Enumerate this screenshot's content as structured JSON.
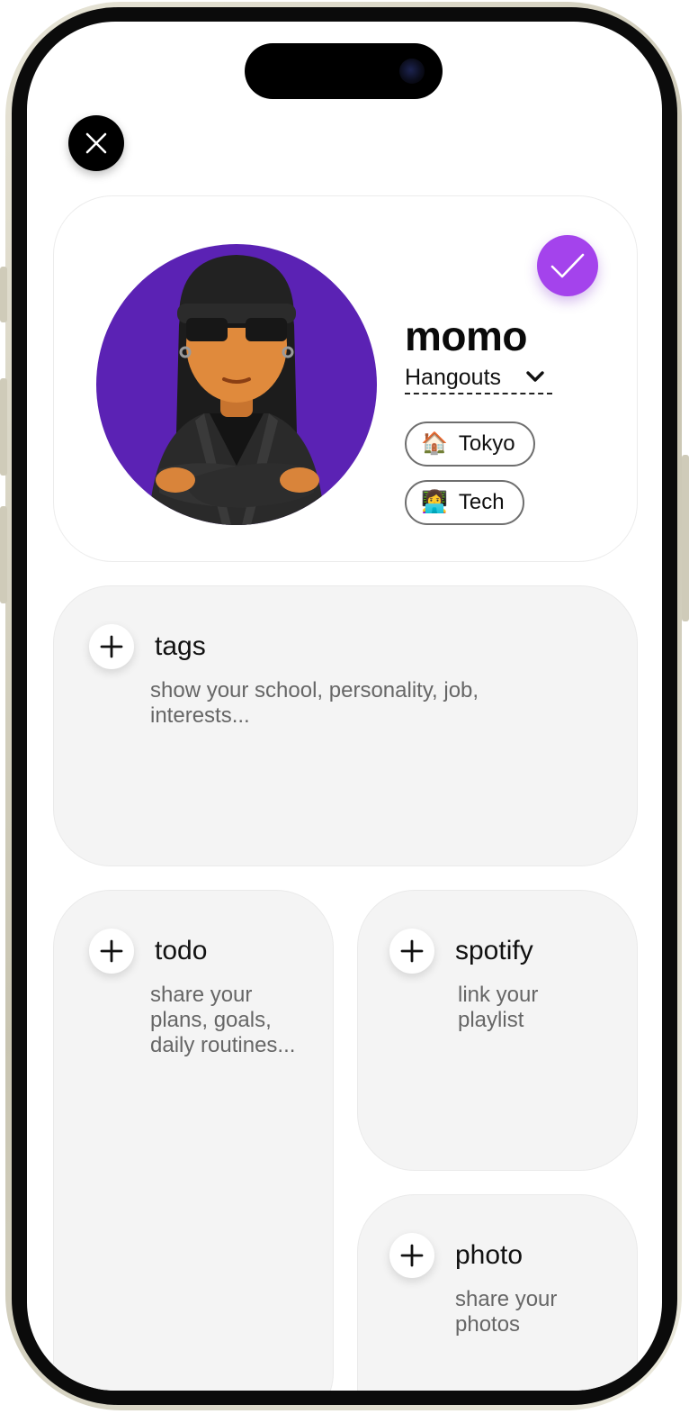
{
  "colors": {
    "accent": "#a443ec",
    "avatar_background": "#5b22b4",
    "card_background": "#f4f4f4"
  },
  "profile": {
    "name": "momo",
    "mode": "Hangouts",
    "tags": [
      {
        "emoji": "🏠",
        "label": "Tokyo"
      },
      {
        "emoji": "👩‍💻",
        "label": "Tech"
      }
    ]
  },
  "icons": {
    "close": "close-icon",
    "confirm": "checkmark-icon",
    "dropdown": "chevron-down-icon",
    "add": "plus-icon"
  },
  "widgets": {
    "tags": {
      "title": "tags",
      "description": "show your school, personality, job, interests..."
    },
    "todo": {
      "title": "todo",
      "description": "share your plans, goals, daily routines..."
    },
    "spotify": {
      "title": "spotify",
      "description": "link your playlist"
    },
    "photo": {
      "title": "photo",
      "description": "share your photos"
    }
  }
}
